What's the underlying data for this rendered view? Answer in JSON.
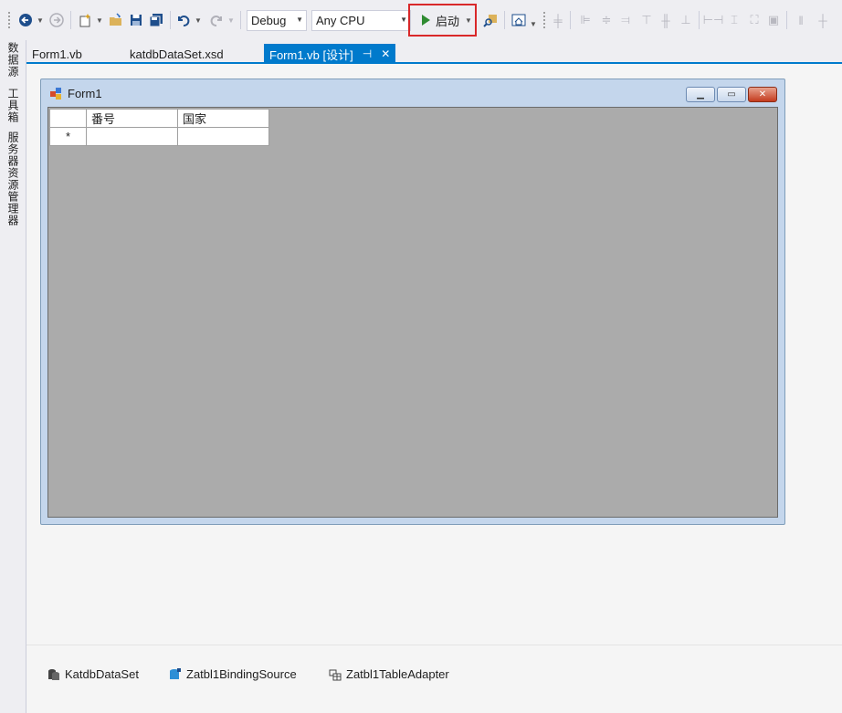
{
  "toolbar": {
    "configuration": "Debug",
    "platform": "Any CPU",
    "start_label": "启动",
    "highlight_color": "#d9282a",
    "play_color": "#2f8b31"
  },
  "side_panels": [
    "数据源",
    "工具箱",
    "服务器资源管理器"
  ],
  "tabs": [
    {
      "label": "Form1.vb",
      "active": false
    },
    {
      "label": "katdbDataSet.xsd",
      "active": false
    },
    {
      "label": "Form1.vb [设计]",
      "active": true
    }
  ],
  "form": {
    "title": "Form1",
    "grid": {
      "columns": [
        "番号",
        "国家"
      ],
      "new_row_marker": "*"
    }
  },
  "components": [
    {
      "label": "KatdbDataSet",
      "icon": "dataset-icon"
    },
    {
      "label": "Zatbl1BindingSource",
      "icon": "binding-source-icon"
    },
    {
      "label": "Zatbl1TableAdapter",
      "icon": "table-adapter-icon"
    }
  ],
  "accent_color": "#007acc"
}
